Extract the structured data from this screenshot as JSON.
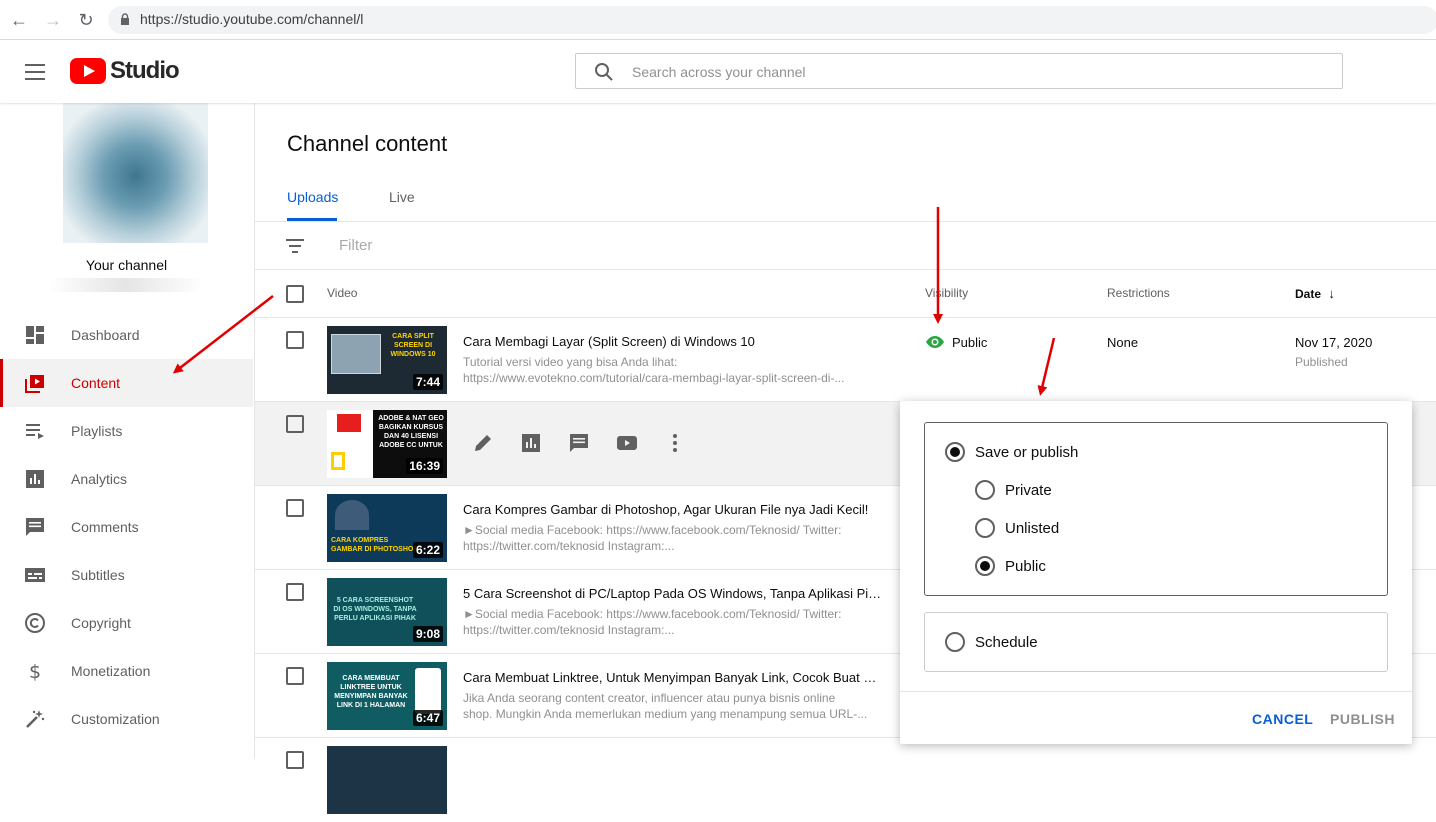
{
  "browser": {
    "url": "https://studio.youtube.com/channel/l"
  },
  "app": {
    "logo_text": "Studio",
    "search_placeholder": "Search across your channel"
  },
  "sidebar": {
    "channel_label": "Your channel",
    "items": [
      {
        "label": "Dashboard",
        "icon": "dashboard-icon"
      },
      {
        "label": "Content",
        "icon": "content-icon",
        "active": true
      },
      {
        "label": "Playlists",
        "icon": "playlists-icon"
      },
      {
        "label": "Analytics",
        "icon": "analytics-icon"
      },
      {
        "label": "Comments",
        "icon": "comments-icon"
      },
      {
        "label": "Subtitles",
        "icon": "subtitles-icon"
      },
      {
        "label": "Copyright",
        "icon": "copyright-icon"
      },
      {
        "label": "Monetization",
        "icon": "monetization-icon"
      },
      {
        "label": "Customization",
        "icon": "customization-icon"
      }
    ]
  },
  "main": {
    "title": "Channel content",
    "tabs": [
      {
        "label": "Uploads",
        "active": true
      },
      {
        "label": "Live"
      }
    ],
    "filter_placeholder": "Filter",
    "columns": {
      "video": "Video",
      "visibility": "Visibility",
      "restrictions": "Restrictions",
      "date": "Date"
    },
    "rows": [
      {
        "thumb_caption": "CARA SPLIT SCREEN DI WINDOWS 10",
        "duration": "7:44",
        "title": "Cara Membagi Layar (Split Screen) di Windows 10",
        "desc1": "Tutorial versi video yang bisa Anda lihat:",
        "desc2": "https://www.evotekno.com/tutorial/cara-membagi-layar-split-screen-di-...",
        "visibility": "Public",
        "restrictions": "None",
        "date": "Nov 17, 2020",
        "date_sub": "Published"
      },
      {
        "thumb_caption": "ADOBE & NAT GEO BAGIKAN KURSUS DAN 40 LISENSI ADOBE CC UNTUK",
        "duration": "16:39"
      },
      {
        "thumb_caption": "CARA KOMPRES GAMBAR DI PHOTOSHOP",
        "duration": "6:22",
        "title": "Cara Kompres Gambar di Photoshop, Agar Ukuran File nya Jadi Kecil!",
        "desc1": "►Social media Facebook: https://www.facebook.com/Teknosid/ Twitter:",
        "desc2": "https://twitter.com/teknosid Instagram:..."
      },
      {
        "thumb_caption": "5 CARA SCREENSHOT DI OS WINDOWS, TANPA PERLU APLIKASI PIHAK",
        "duration": "9:08",
        "title": "5 Cara Screenshot di PC/Laptop Pada OS Windows, Tanpa Aplikasi Pih...",
        "desc1": "►Social media Facebook: https://www.facebook.com/Teknosid/ Twitter:",
        "desc2": "https://twitter.com/teknosid Instagram:..."
      },
      {
        "thumb_caption": "CARA MEMBUAT LINKTREE UNTUK MENYIMPAN BANYAK LINK DI 1 HALAMAN",
        "duration": "6:47",
        "title": "Cara Membuat Linktree, Untuk Menyimpan Banyak Link, Cocok Buat Pr...",
        "desc1": "Jika Anda seorang content creator, influencer atau punya bisnis online",
        "desc2": "shop. Mungkin Anda memerlukan medium yang menampung semua URL-..."
      }
    ]
  },
  "popup": {
    "save_or_publish": "Save or publish",
    "private": "Private",
    "unlisted": "Unlisted",
    "public": "Public",
    "schedule": "Schedule",
    "cancel": "CANCEL",
    "publish": "PUBLISH",
    "selected": "Public"
  },
  "colors": {
    "accent_blue": "#065fd4",
    "brand_red": "#ff0000",
    "active_red": "#cc0000",
    "public_green": "#2ba640",
    "annotation_arrow": "#e00000"
  }
}
